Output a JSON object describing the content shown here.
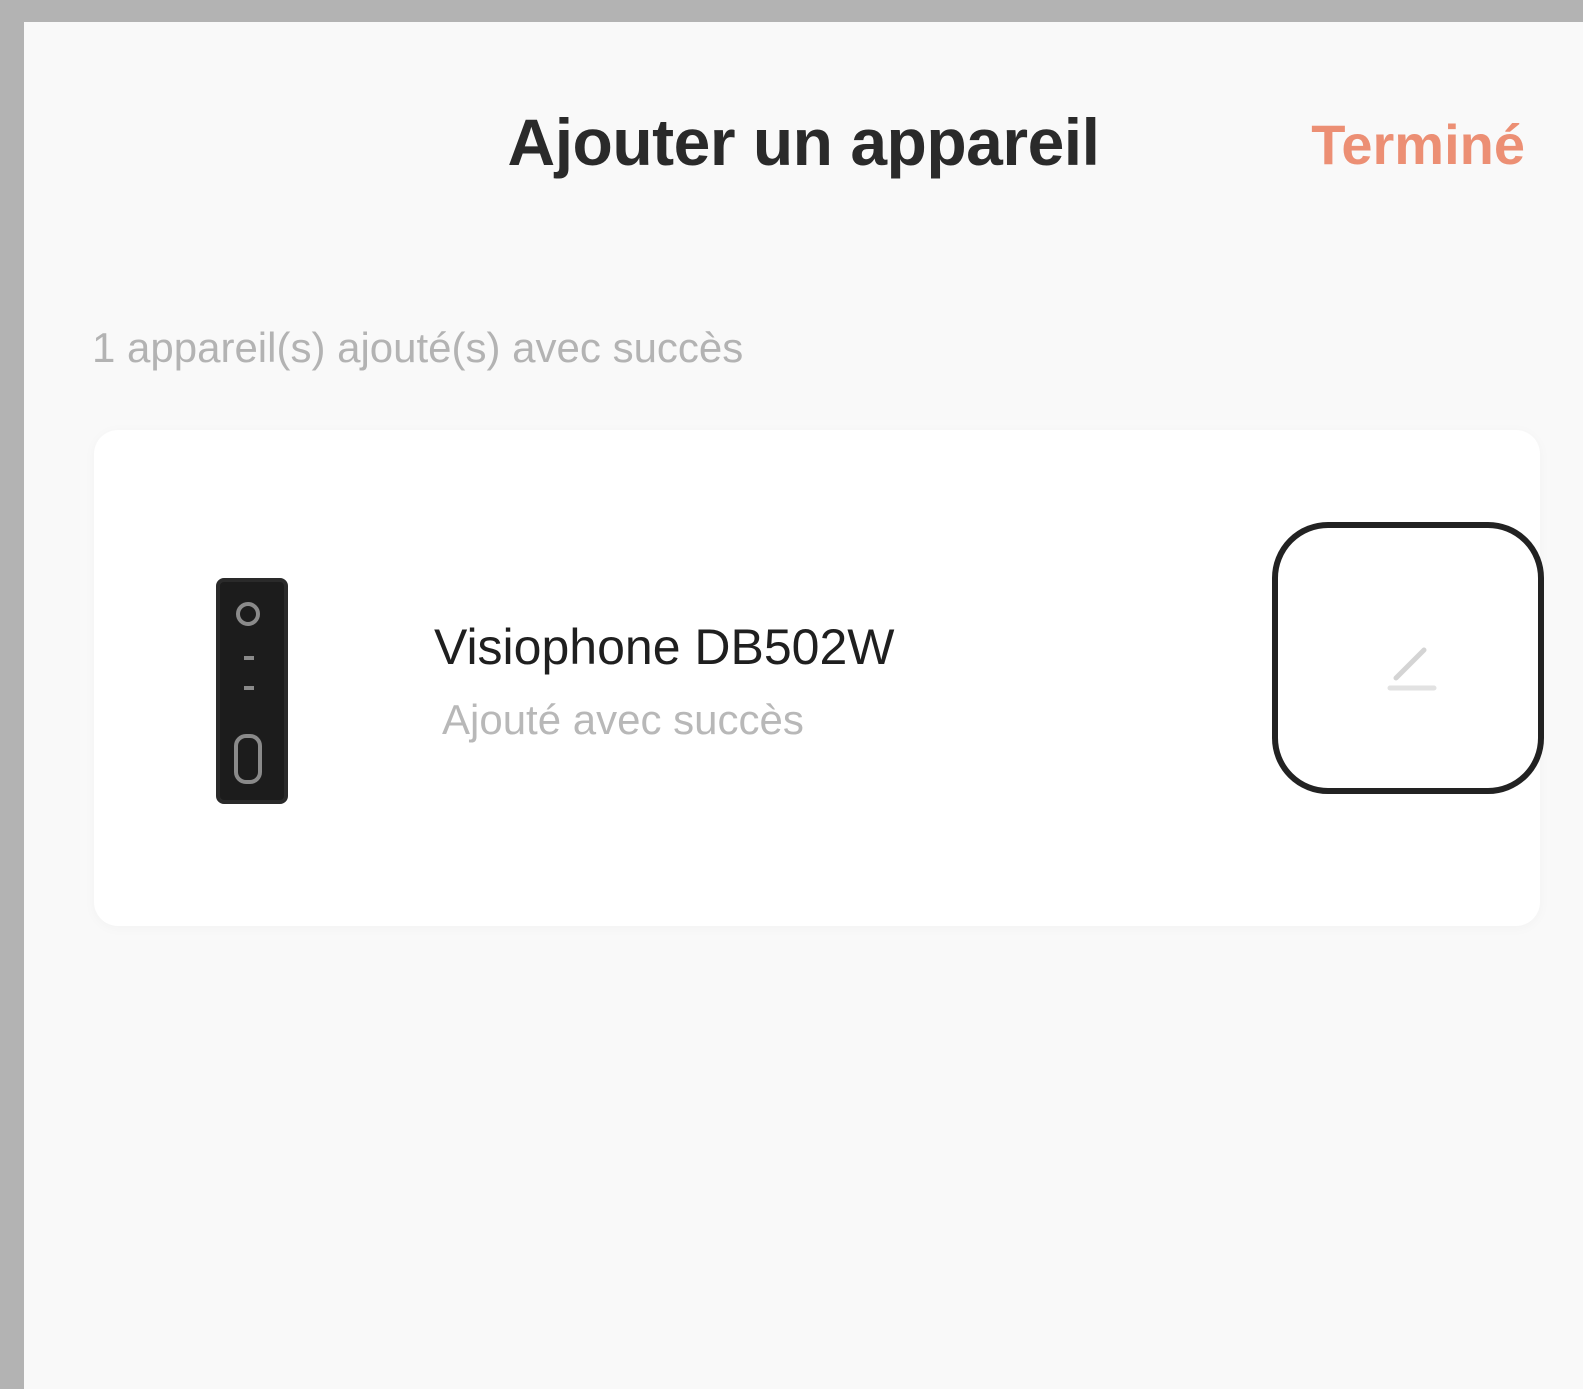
{
  "header": {
    "title": "Ajouter un appareil",
    "done_label": "Terminé"
  },
  "summary": {
    "text": "1 appareil(s) ajouté(s) avec succès"
  },
  "device": {
    "name": "Visiophone DB502W",
    "status": "Ajouté avec succès",
    "icon": "doorbell-device-image"
  },
  "colors": {
    "accent": "#ec8f74",
    "background": "#f9f9f9",
    "card": "#ffffff"
  }
}
